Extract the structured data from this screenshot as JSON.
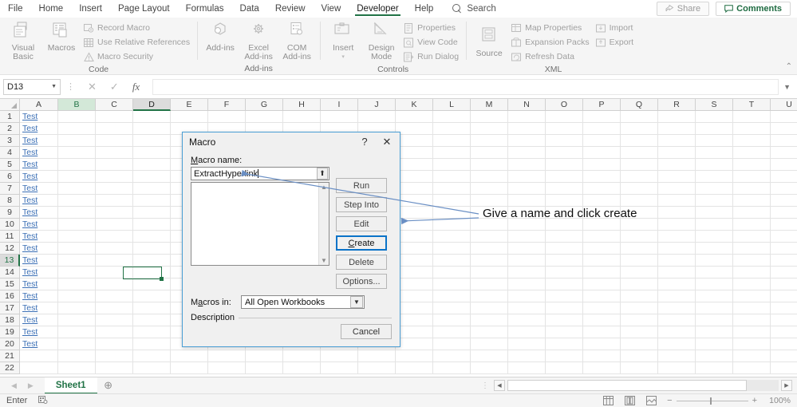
{
  "app": {
    "ribbon_tabs": [
      {
        "label": "File",
        "active": false
      },
      {
        "label": "Home",
        "active": false
      },
      {
        "label": "Insert",
        "active": false
      },
      {
        "label": "Page Layout",
        "active": false
      },
      {
        "label": "Formulas",
        "active": false
      },
      {
        "label": "Data",
        "active": false
      },
      {
        "label": "Review",
        "active": false
      },
      {
        "label": "View",
        "active": false
      },
      {
        "label": "Developer",
        "active": true
      },
      {
        "label": "Help",
        "active": false
      }
    ],
    "search_placeholder": "Search",
    "share_label": "Share",
    "comments_label": "Comments",
    "accent_green": "#217346",
    "focus_blue": "#0a73c8"
  },
  "ribbon": {
    "groups": [
      {
        "label": "Code",
        "big_buttons": [
          {
            "label": "Visual Basic",
            "icon": "visual-basic-icon"
          },
          {
            "label": "Macros",
            "icon": "macros-icon"
          }
        ],
        "small_buttons": [
          {
            "label": "Record Macro",
            "icon": "record-macro-icon"
          },
          {
            "label": "Use Relative References",
            "icon": "relative-references-icon"
          },
          {
            "label": "Macro Security",
            "icon": "macro-security-icon"
          }
        ]
      },
      {
        "label": "Add-ins",
        "big_buttons": [
          {
            "label": "Add-ins",
            "icon": "addins-icon"
          },
          {
            "label": "Excel Add-ins",
            "icon": "excel-addins-icon"
          },
          {
            "label": "COM Add-ins",
            "icon": "com-addins-icon"
          }
        ],
        "small_buttons": []
      },
      {
        "label": "Controls",
        "big_buttons": [
          {
            "label": "Insert",
            "icon": "insert-control-icon"
          },
          {
            "label": "Design Mode",
            "icon": "design-mode-icon"
          }
        ],
        "small_buttons": [
          {
            "label": "Properties",
            "icon": "properties-icon"
          },
          {
            "label": "View Code",
            "icon": "view-code-icon"
          },
          {
            "label": "Run Dialog",
            "icon": "run-dialog-icon"
          }
        ]
      },
      {
        "label": "XML",
        "big_buttons": [
          {
            "label": "Source",
            "icon": "xml-source-icon"
          }
        ],
        "small_buttons": [
          {
            "label": "Map Properties",
            "icon": "map-properties-icon"
          },
          {
            "label": "Expansion Packs",
            "icon": "expansion-packs-icon"
          },
          {
            "label": "Refresh Data",
            "icon": "refresh-data-icon"
          },
          {
            "label": "Import",
            "icon": "import-icon"
          },
          {
            "label": "Export",
            "icon": "export-icon"
          }
        ]
      }
    ]
  },
  "formula_bar": {
    "name_box_value": "D13",
    "formula_value": "",
    "cancel_icon": "cancel-icon",
    "confirm_icon": "confirm-icon",
    "fx_icon": "insert-function-icon"
  },
  "grid": {
    "columns": [
      "A",
      "B",
      "C",
      "D",
      "E",
      "F",
      "G",
      "H",
      "I",
      "J",
      "K",
      "L",
      "M",
      "N",
      "O",
      "P",
      "Q",
      "R",
      "S",
      "T",
      "U"
    ],
    "rows": [
      1,
      2,
      3,
      4,
      5,
      6,
      7,
      8,
      9,
      10,
      11,
      12,
      13,
      14,
      15,
      16,
      17,
      18,
      19,
      20,
      21,
      22
    ],
    "highlighted_column_green": "B",
    "selected_column": "D",
    "selected_row": 13,
    "selected_cell": "D13",
    "column_a_values": [
      "Test",
      "Test",
      "Test",
      "Test",
      "Test",
      "Test",
      "Test",
      "Test",
      "Test",
      "Test",
      "Test",
      "Test",
      "Test",
      "Test",
      "Test",
      "Test",
      "Test",
      "Test",
      "Test",
      "Test",
      "",
      ""
    ],
    "hyperlink_color": "#3b6fb5"
  },
  "dialog": {
    "title": "Macro",
    "help_icon": "help-icon",
    "close_icon": "close-icon",
    "macro_name_label": "Macro name:",
    "macro_name_value": "ExtractHyperlink",
    "spin_icon": "spin-up-icon",
    "list_items": [],
    "buttons": [
      {
        "label": "Run",
        "focused": false
      },
      {
        "label": "Step Into",
        "focused": false
      },
      {
        "label": "Edit",
        "focused": false
      },
      {
        "label": "Create",
        "focused": true
      },
      {
        "label": "Delete",
        "focused": false
      },
      {
        "label": "Options...",
        "focused": false
      }
    ],
    "macros_in_label": "Macros in:",
    "macros_in_value": "All Open Workbooks",
    "description_label": "Description",
    "description_value": "",
    "cancel_label": "Cancel"
  },
  "annotation": {
    "text": "Give a name and click create",
    "color": "#6a8fc4"
  },
  "sheet_bar": {
    "prev_icon": "prev-sheet-icon",
    "next_icon": "next-sheet-icon",
    "tabs": [
      {
        "label": "Sheet1",
        "active": true
      }
    ],
    "add_sheet_icon": "add-sheet-icon"
  },
  "status_bar": {
    "mode": "Enter",
    "macro_record_icon": "record-macro-status-icon",
    "view_buttons": [
      {
        "icon": "normal-view-icon"
      },
      {
        "icon": "page-layout-view-icon"
      },
      {
        "icon": "page-break-view-icon"
      }
    ],
    "zoom_out_label": "−",
    "zoom_in_label": "+",
    "zoom_level": "100%"
  }
}
